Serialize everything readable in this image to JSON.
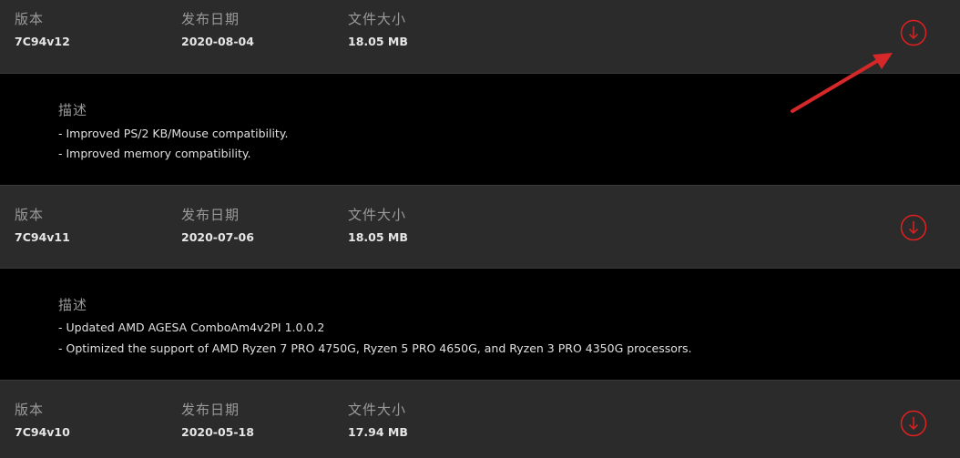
{
  "labels": {
    "version": "版本",
    "release_date": "发布日期",
    "file_size": "文件大小",
    "description": "描述"
  },
  "entries": [
    {
      "version": "7C94v12",
      "date": "2020-08-04",
      "size": "18.05 MB",
      "description": [
        "- Improved PS/2 KB/Mouse compatibility.",
        "- Improved memory compatibility."
      ]
    },
    {
      "version": "7C94v11",
      "date": "2020-07-06",
      "size": "18.05 MB",
      "description": [
        "- Updated AMD AGESA ComboAm4v2PI 1.0.0.2",
        "- Optimized the support of AMD Ryzen 7 PRO 4750G, Ryzen 5 PRO 4650G, and Ryzen 3 PRO 4350G processors."
      ]
    },
    {
      "version": "7C94v10",
      "date": "2020-05-18",
      "size": "17.94 MB",
      "description": []
    }
  ],
  "icons": {
    "download": "download-icon",
    "annotation": "red-arrow-annotation"
  },
  "colors": {
    "header_bg": "#2b2b2b",
    "desc_bg": "#000000",
    "accent_red": "#e02020",
    "annotation_red": "#d62828"
  }
}
